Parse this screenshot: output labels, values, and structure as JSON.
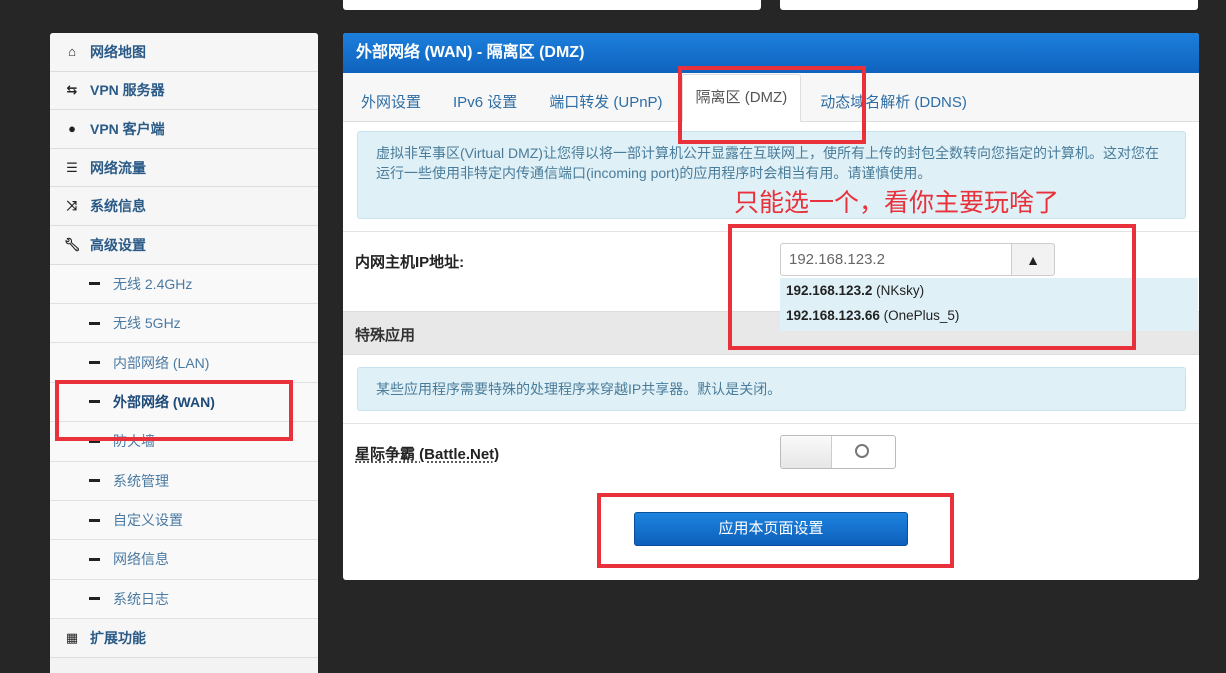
{
  "sidebar": {
    "items": [
      {
        "label": "网络地图",
        "icon": "home-icon"
      },
      {
        "label": "VPN 服务器",
        "icon": "vpn-server-icon"
      },
      {
        "label": "VPN 客户端",
        "icon": "globe-icon"
      },
      {
        "label": "网络流量",
        "icon": "traffic-icon"
      },
      {
        "label": "系统信息",
        "icon": "shuffle-icon"
      },
      {
        "label": "高级设置",
        "icon": "wrench-icon"
      }
    ],
    "subitems": [
      "无线 2.4GHz",
      "无线 5GHz",
      "内部网络 (LAN)",
      "外部网络 (WAN)",
      "防火墙",
      "系统管理",
      "自定义设置",
      "网络信息",
      "系统日志"
    ],
    "active_subitem": "外部网络 (WAN)",
    "extensions": {
      "label": "扩展功能",
      "icon": "grid-icon"
    }
  },
  "panel": {
    "title": "外部网络 (WAN) - 隔离区 (DMZ)",
    "tabs": [
      "外网设置",
      "IPv6 设置",
      "端口转发 (UPnP)",
      "隔离区 (DMZ)",
      "动态域名解析 (DDNS)"
    ],
    "active_tab": "隔离区 (DMZ)",
    "info": "虚拟非军事区(Virtual DMZ)让您得以将一部计算机公开显露在互联网上，使所有上传的封包全数转向您指定的计算机。这对您在运行一些使用非特定内传通信端口(incoming port)的应用程序时会相当有用。请谨慎使用。",
    "host_ip_label": "内网主机IP地址:",
    "host_ip_value": "192.168.123.2",
    "dropdown": [
      {
        "ip": "192.168.123.2",
        "name": "(NKsky)"
      },
      {
        "ip": "192.168.123.66",
        "name": "(OnePlus_5)"
      }
    ],
    "special_title": "特殊应用",
    "special_info": "某些应用程序需要特殊的处理程序来穿越IP共享器。默认是关闭。",
    "battlenet_label": "星际争霸 (Battle.Net)",
    "battlenet_enabled": false,
    "apply_button": "应用本页面设置"
  },
  "annotation": {
    "text": "只能选一个，看你主要玩啥了",
    "color": "#e8313a"
  }
}
